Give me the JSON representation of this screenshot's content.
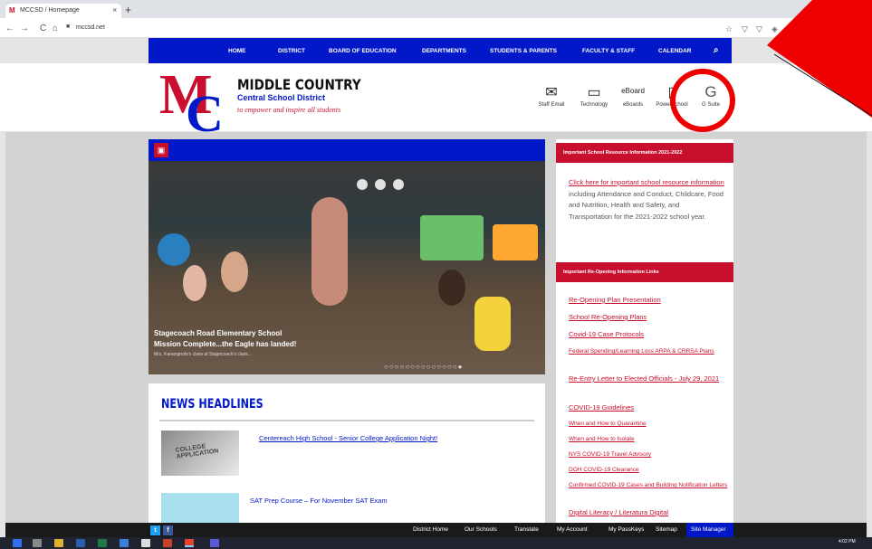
{
  "browser": {
    "tab_title": "MCCSD / Homepage",
    "tab_close": "×",
    "new_tab": "+",
    "url": "mccsd.net",
    "back": "←",
    "forward": "→",
    "reload": "C",
    "home": "⌂",
    "lock": "🔒",
    "ext_icons": [
      "☆",
      "▽",
      "▽",
      "◈",
      "●"
    ]
  },
  "topnav": {
    "items": [
      "HOME",
      "DISTRICT",
      "BOARD OF EDUCATION",
      "DEPARTMENTS",
      "STUDENTS & PARENTS",
      "FACULTY & STAFF",
      "CALENDAR"
    ],
    "search_icon": "search-icon"
  },
  "header": {
    "logo_m": "M",
    "logo_c": "C",
    "title": "MIDDLE COUNTRY",
    "subtitle": "Central School District",
    "tagline": "to empower and inspire all students",
    "quicklinks": [
      {
        "icon": "✉",
        "label": "Staff Email"
      },
      {
        "icon": "▭",
        "label": "Technology"
      },
      {
        "icon": "eBoard",
        "label": "eBoards"
      },
      {
        "icon": "▯",
        "label": "PowerSchool"
      },
      {
        "icon": "G",
        "label": "G Suite"
      }
    ]
  },
  "slider": {
    "caption_line1": "Stagecoach Road Elementary School",
    "caption_line2": "Mission Complete...the Eagle has landed!",
    "caption_line3": "Mrs. Kanangnolo's class at Stagecoach's class...",
    "dots": "○○○○○○○○○○○○○○●"
  },
  "news": {
    "heading": "NEWS HEADLINES",
    "img1_text": "COLLEGE APPLICATION",
    "item1": "Centereach High School - Senior College Application Night!",
    "item2": "SAT Prep Course – For November SAT Exam"
  },
  "sidebar": {
    "box1_title": "Important School Resource Information 2021-2022",
    "box1_link": "Click here for important school resource information",
    "box1_text": " including Attendance and Conduct, Childcare, Food and Nutrition, Health and Safety, and Transportation for the 2021-2022 school year.",
    "box2_title": "Important Re-Opening Information Links",
    "links": [
      "Re-Opening Plan Presentation",
      "School Re-Opening Plans",
      "Covid-19 Case Protocols",
      "Federal Spending/Learning Loss ARPA & CRRSA Plans",
      "Re-Entry Letter to Elected Officials - July 29, 2021",
      "COVID-19 Guidelines",
      "When and How to Quarantine",
      "When and How to Isolate",
      "NYS COVID-19 Travel Advisory",
      "DOH COVID-19 Clearance",
      "Confirmed COVID-19 Cases and Building Notification Letters",
      "Digital Literacy / Literatura Digital"
    ]
  },
  "footer": {
    "items": [
      "District Home",
      "Our Schools",
      "Translate",
      "My Account",
      "My PassKeys",
      "Sitemap",
      "Site Manager"
    ],
    "twitter": "t",
    "facebook": "f"
  },
  "taskbar": {
    "clock": "4:02 PM"
  },
  "colors": {
    "brand_blue": "#0018c8",
    "brand_red": "#c8102e",
    "annotation_red": "#ee0000"
  }
}
